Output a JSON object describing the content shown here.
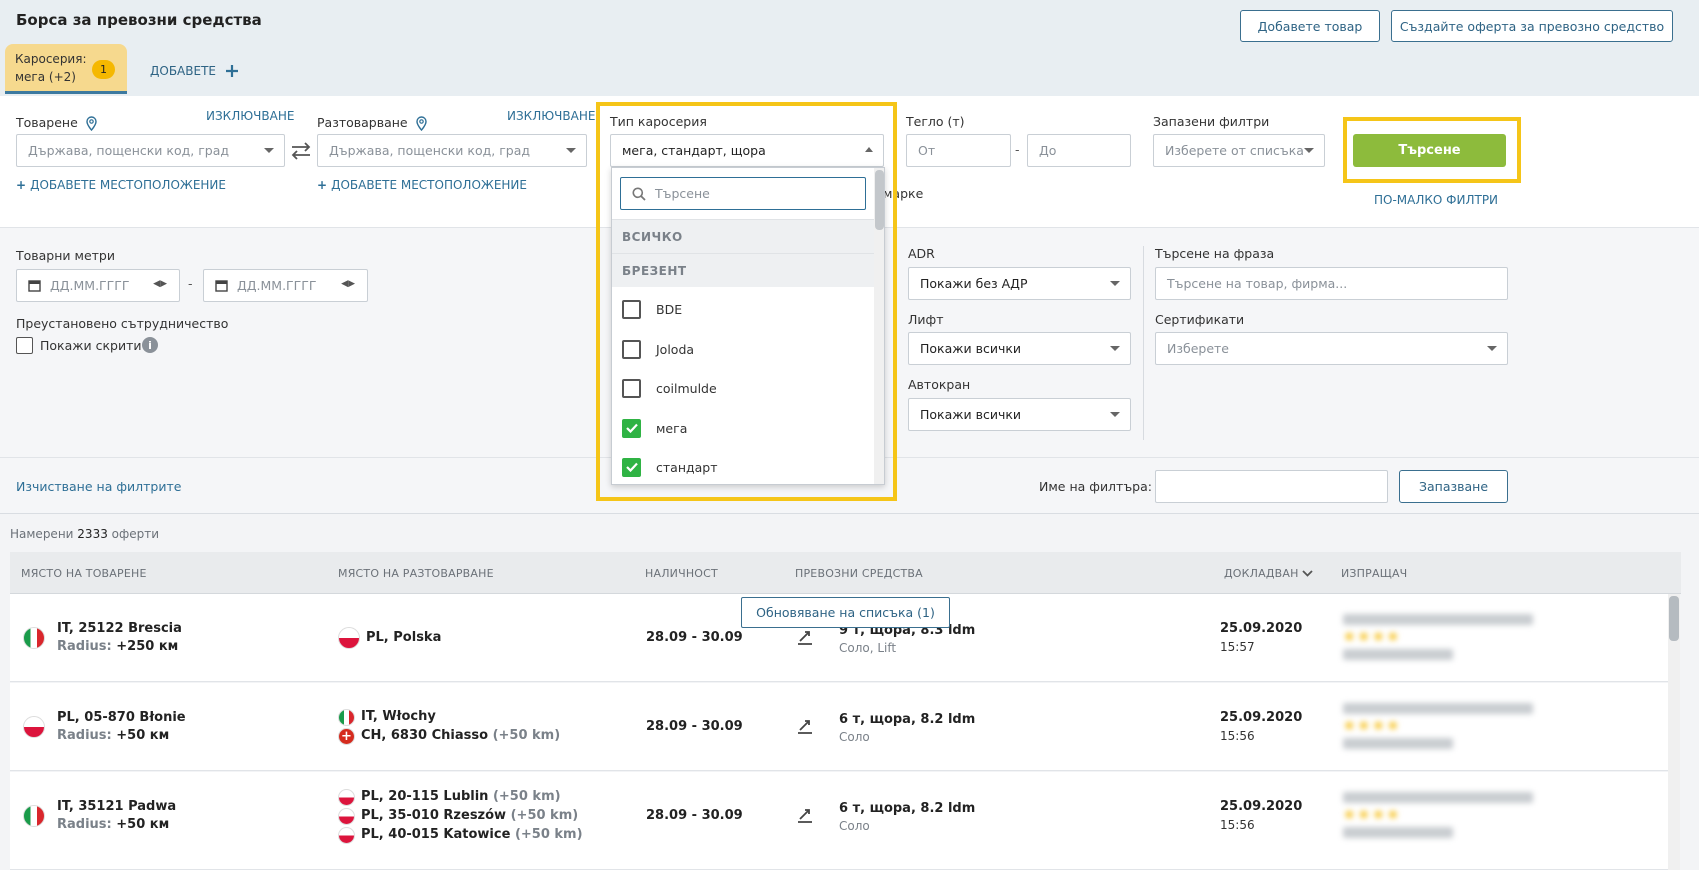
{
  "header": {
    "title": "Борса за превозни средства",
    "add_goods_button": "Добавете товар",
    "create_offer_button": "Създайте оферта за превозно средство"
  },
  "tabs": {
    "active_line1": "Каросерия:",
    "active_line2": "мега (+2)",
    "active_badge": "1",
    "add_label": "ДОБАВЕТЕ"
  },
  "filters": {
    "loading_label": "Товарене",
    "loading_exclude": "ИЗКЛЮЧВАНЕ",
    "loading_placeholder": "Държава, пощенски код, град",
    "loading_add_location": "ДОБАВЕТЕ МЕСТОПОЛОЖЕНИЕ",
    "unloading_label": "Разтоварване",
    "unloading_exclude": "ИЗКЛЮЧВАНЕ",
    "unloading_placeholder": "Държава, пощенски код, град",
    "unloading_add_location": "ДОБАВЕТЕ МЕСТОПОЛОЖЕНИЕ",
    "body_type_label": "Тип каросерия",
    "body_type_value": "мега, стандарт, щора",
    "weight_label": "Тегло (т)",
    "weight_from_placeholder": "От",
    "weight_to_placeholder": "До",
    "saved_filters_label": "Запазени филтри",
    "saved_filters_placeholder": "Изберете от списъка",
    "search_button": "Търсене",
    "fewer_filters": "ПО-МАЛКО ФИЛТРИ",
    "partial_text": "марке",
    "cargo_meters_label": "Товарни метри",
    "date_placeholder_1": "ДД.ММ.ГГГГ",
    "date_placeholder_2": "ДД.ММ.ГГГГ",
    "suspended_label": "Преустановено сътрудничество",
    "show_hidden_label": "Покажи скрити",
    "adr_label": "ADR",
    "adr_value": "Покажи без АДР",
    "lift_label": "Лифт",
    "lift_value": "Покажи всички",
    "crane_label": "Автокран",
    "crane_value": "Покажи всички",
    "phrase_label": "Търсене на фраза",
    "phrase_placeholder": "Търсене на товар, фирма...",
    "certificates_label": "Сертификати",
    "certificates_placeholder": "Изберете",
    "clear_filters": "Изчистване на филтрите",
    "filter_name_label": "Име на филтъра:",
    "save_button": "Запазване"
  },
  "dropdown": {
    "search_placeholder": "Търсене",
    "group_all": "ВСИЧКО",
    "group_tarp": "БРЕЗЕНТ",
    "items": [
      {
        "label": "BDE",
        "checked": false
      },
      {
        "label": "Joloda",
        "checked": false
      },
      {
        "label": "coilmulde",
        "checked": false
      },
      {
        "label": "мега",
        "checked": true
      },
      {
        "label": "стандарт",
        "checked": true
      }
    ]
  },
  "results": {
    "count_prefix": "Намерени",
    "count": "2333",
    "count_suffix": "оферти",
    "refresh_button": "Обновяване на списъка (1)",
    "columns": {
      "loading": "МЯСТО НА ТОВАРЕНЕ",
      "unloading": "МЯСТО НА РАЗТОВАРВАНЕ",
      "availability": "НАЛИЧНОСТ",
      "vehicles": "ПРЕВОЗНИ СРЕДСТВА",
      "reported": "ДОКЛАДВАН",
      "sender": "ИЗПРАЩАЧ"
    },
    "rows": [
      {
        "loading": "IT, 25122 Brescia",
        "radius_label": "Radius:",
        "radius": "+250 км",
        "unloading": [
          {
            "text": "PL, Polska",
            "km": ""
          }
        ],
        "availability": "28.09 - 30.09",
        "vehicle": "9 т, щора, 8.3 ldm",
        "vehicle_sub": "Соло, Lift",
        "date": "25.09.2020",
        "time": "15:57"
      },
      {
        "loading": "PL, 05-870 Błonie",
        "radius_label": "Radius:",
        "radius": "+50 км",
        "unloading": [
          {
            "text": "IT, Włochy",
            "km": ""
          },
          {
            "text": "CH, 6830 Chiasso",
            "km": "(+50 km)"
          }
        ],
        "availability": "28.09 - 30.09",
        "vehicle": "6 т, щора, 8.2 ldm",
        "vehicle_sub": "Соло",
        "date": "25.09.2020",
        "time": "15:56"
      },
      {
        "loading": "IT, 35121 Padwa",
        "radius_label": "Radius:",
        "radius": "+50 км",
        "unloading": [
          {
            "text": "PL, 20-115 Lublin",
            "km": "(+50 km)"
          },
          {
            "text": "PL, 35-010 Rzeszów",
            "km": "(+50 km)"
          },
          {
            "text": "PL, 40-015 Katowice",
            "km": "(+50 km)"
          }
        ],
        "availability": "28.09 - 30.09",
        "vehicle": "6 т, щора, 8.2 ldm",
        "vehicle_sub": "Соло",
        "date": "25.09.2020",
        "time": "15:56"
      }
    ]
  }
}
